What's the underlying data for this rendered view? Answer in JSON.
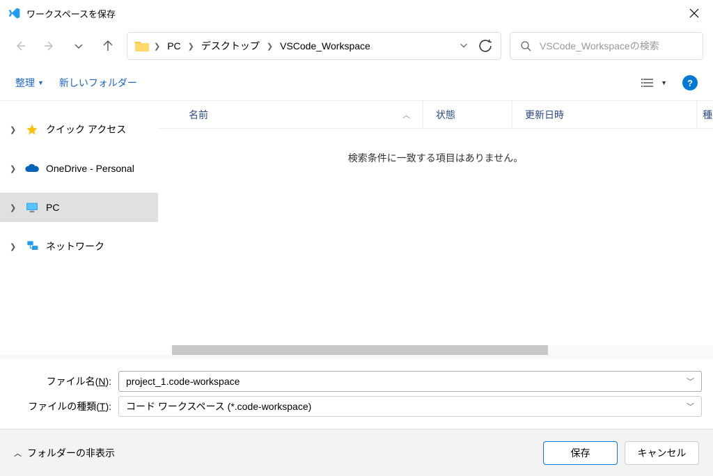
{
  "window": {
    "title": "ワークスペースを保存"
  },
  "nav": {
    "crumbs": [
      "PC",
      "デスクトップ",
      "VSCode_Workspace"
    ]
  },
  "search": {
    "placeholder": "VSCode_Workspaceの検索"
  },
  "toolbar": {
    "organize": "整理",
    "new_folder": "新しいフォルダー"
  },
  "sidebar": {
    "items": [
      {
        "label": "クイック アクセス",
        "icon": "star"
      },
      {
        "label": "OneDrive - Personal",
        "icon": "onedrive"
      },
      {
        "label": "PC",
        "icon": "pc",
        "selected": true
      },
      {
        "label": "ネットワーク",
        "icon": "network"
      }
    ]
  },
  "columns": {
    "name": "名前",
    "status": "状態",
    "date": "更新日時",
    "type": "種"
  },
  "content": {
    "empty_message": "検索条件に一致する項目はありません。"
  },
  "form": {
    "filename_label_pre": "ファイル名(",
    "filename_label_u": "N",
    "filename_label_post": "):",
    "filename_value": "project_1.code-workspace",
    "filetype_label_pre": "ファイルの種類(",
    "filetype_label_u": "T",
    "filetype_label_post": "):",
    "filetype_value": "コード ワークスペース (*.code-workspace)"
  },
  "footer": {
    "hide_folders": "フォルダーの非表示",
    "save": "保存",
    "cancel": "キャンセル"
  }
}
